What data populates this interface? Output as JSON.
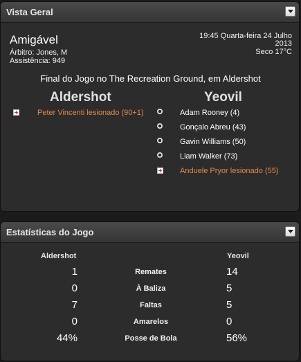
{
  "overview": {
    "title": "Vista Geral",
    "match_type": "Amigável",
    "referee": "Árbitro: Jones, M",
    "attendance": "Assistência: 949",
    "datetime_line1": "19:45 Quarta-feira 24 Julho",
    "datetime_line2": "2013",
    "weather": "Seco 17°C",
    "result_line": "Final do Jogo no The Recreation Ground, em Aldershot",
    "home_team": "Aldershot",
    "away_team": "Yeovil",
    "home_events": [
      {
        "icon": "injury-icon",
        "text": "Peter Vincenti lesionado (90+1)"
      }
    ],
    "away_events": [
      {
        "icon": "ball-icon",
        "text": "Adam Rooney (4)"
      },
      {
        "icon": "ball-icon",
        "text": "Gonçalo Abreu (43)"
      },
      {
        "icon": "ball-icon",
        "text": "Gavin Williams (50)"
      },
      {
        "icon": "ball-icon",
        "text": "Liam Walker (73)"
      },
      {
        "icon": "injury-icon",
        "text": "Anduele Pryor lesionado (55)"
      }
    ]
  },
  "stats": {
    "title": "Estatísticas do Jogo",
    "home_team": "Aldershot",
    "away_team": "Yeovil",
    "rows": [
      {
        "label": "Remates",
        "home": "1",
        "away": "14"
      },
      {
        "label": "À Baliza",
        "home": "0",
        "away": "5"
      },
      {
        "label": "Faltas",
        "home": "7",
        "away": "5"
      },
      {
        "label": "Amarelos",
        "home": "0",
        "away": "0"
      },
      {
        "label": "Posse de Bola",
        "home": "44%",
        "away": "56%"
      }
    ]
  },
  "colors": {
    "injury_text": "#e38a4c",
    "panel_bg": "#2c2c2c",
    "page_bg": "#1b1b1b"
  }
}
